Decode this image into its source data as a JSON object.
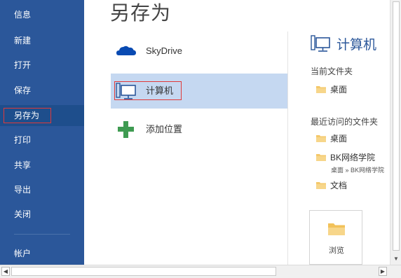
{
  "nav": {
    "items": [
      {
        "label": "信息"
      },
      {
        "label": "新建"
      },
      {
        "label": "打开"
      },
      {
        "label": "保存"
      },
      {
        "label": "另存为",
        "selected": true
      },
      {
        "label": "打印"
      },
      {
        "label": "共享"
      },
      {
        "label": "导出"
      },
      {
        "label": "关闭"
      },
      {
        "label": "帐户"
      }
    ]
  },
  "page_title": "另存为",
  "places": [
    {
      "label": "SkyDrive",
      "icon": "cloud-icon"
    },
    {
      "label": "计算机",
      "icon": "computer-icon",
      "selected": true
    },
    {
      "label": "添加位置",
      "icon": "plus-icon"
    }
  ],
  "right_panel": {
    "title": "计算机",
    "current_folder_heading": "当前文件夹",
    "current_folder": {
      "name": "桌面"
    },
    "recent_heading": "最近访问的文件夹",
    "recent_folders": [
      {
        "name": "桌面"
      },
      {
        "name": "BK网络学院",
        "path": "桌面 » BK网络学院"
      },
      {
        "name": "文档"
      }
    ],
    "browse_label": "浏览"
  },
  "colors": {
    "nav_background": "#2b579a",
    "nav_selected": "#1e4e8c",
    "place_selected": "#c5d8f1",
    "accent_title": "#2b579a",
    "highlight_outline": "#e03a3a",
    "folder": "#f4c86a"
  }
}
